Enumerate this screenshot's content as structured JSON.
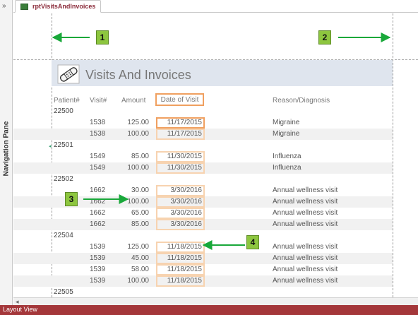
{
  "navigation_pane": {
    "label": "Navigation Pane",
    "toggle_glyph": "»"
  },
  "tab": {
    "title": "rptVisitsAndInvoices",
    "icon": "report-icon"
  },
  "report": {
    "title": "Visits And Invoices",
    "icon": "bandage-icon",
    "columns": {
      "patient": "Patient#",
      "visit": "Visit#",
      "amount": "Amount",
      "date": "Date of Visit",
      "reason": "Reason/Diagnosis"
    },
    "groups": [
      {
        "patient": "22500",
        "rows": [
          {
            "visit": "1538",
            "amount": "125.00",
            "date": "11/17/2015",
            "reason": "Migraine"
          },
          {
            "visit": "1538",
            "amount": "100.00",
            "date": "11/17/2015",
            "reason": "Migraine"
          }
        ]
      },
      {
        "patient": "22501",
        "rows": [
          {
            "visit": "1549",
            "amount": "85.00",
            "date": "11/30/2015",
            "reason": "Influenza"
          },
          {
            "visit": "1549",
            "amount": "100.00",
            "date": "11/30/2015",
            "reason": "Influenza"
          }
        ]
      },
      {
        "patient": "22502",
        "rows": [
          {
            "visit": "1662",
            "amount": "30.00",
            "date": "3/30/2016",
            "reason": "Annual wellness visit"
          },
          {
            "visit": "1662",
            "amount": "100.00",
            "date": "3/30/2016",
            "reason": "Annual wellness visit"
          },
          {
            "visit": "1662",
            "amount": "65.00",
            "date": "3/30/2016",
            "reason": "Annual wellness visit"
          },
          {
            "visit": "1662",
            "amount": "85.00",
            "date": "3/30/2016",
            "reason": "Annual wellness visit"
          }
        ]
      },
      {
        "patient": "22504",
        "rows": [
          {
            "visit": "1539",
            "amount": "125.00",
            "date": "11/18/2015",
            "reason": "Annual wellness visit"
          },
          {
            "visit": "1539",
            "amount": "45.00",
            "date": "11/18/2015",
            "reason": "Annual wellness visit"
          },
          {
            "visit": "1539",
            "amount": "58.00",
            "date": "11/18/2015",
            "reason": "Annual wellness visit"
          },
          {
            "visit": "1539",
            "amount": "100.00",
            "date": "11/18/2015",
            "reason": "Annual wellness visit"
          }
        ]
      },
      {
        "patient": "22505",
        "rows": []
      }
    ]
  },
  "callouts": [
    "1",
    "2",
    "3",
    "4"
  ],
  "status_bar": {
    "text": "Layout View"
  },
  "colors": {
    "accent_orange": "#f0a060",
    "callout_green": "#8dc63f",
    "arrow_green": "#19a83a",
    "status_bar": "#a4373a",
    "title_band": "#dfe5ee"
  }
}
